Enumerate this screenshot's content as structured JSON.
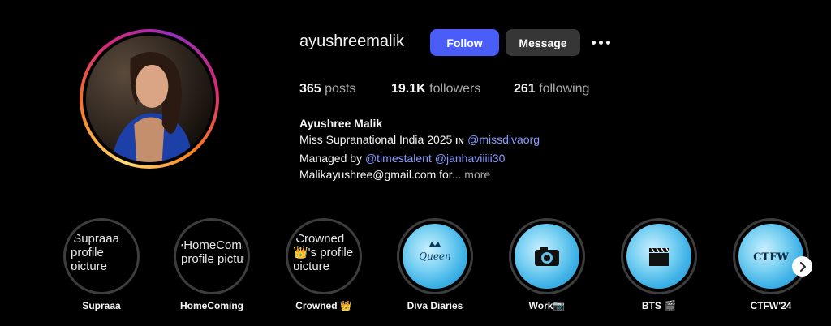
{
  "profile": {
    "username": "ayushreemalik",
    "follow_label": "Follow",
    "message_label": "Message"
  },
  "stats": {
    "posts_count": "365",
    "posts_label": "posts",
    "followers_count": "19.1K",
    "followers_label": "followers",
    "following_count": "261",
    "following_label": "following"
  },
  "bio": {
    "name": "Ayushree Malik",
    "line1_text": "Miss Supranational India 2025 ",
    "line1_badge": "IN",
    "line1_mention": "@missdivaorg",
    "line2_text": "Managed by ",
    "line2_mention1": "@timestalent",
    "line2_mention2": "@janhaviiiii30",
    "line3_text": "Malikayushree@gmail.com for...",
    "more_label": "more"
  },
  "highlights": [
    {
      "label": "Supraaa",
      "alt_line1": "Supraaa",
      "alt_line2": "profile",
      "alt_line3": "picture",
      "type": "broken"
    },
    {
      "label": "HomeComing",
      "alt_line1": "HomeComin",
      "alt_line2": "profile pictur",
      "alt_line3": "",
      "type": "broken"
    },
    {
      "label": "Crowned 👑",
      "alt_line1": "Crowned",
      "alt_line2": "👑's profile",
      "alt_line3": "picture",
      "type": "broken"
    },
    {
      "label": "Diva Diaries",
      "cover_text": "Queen",
      "type": "blue",
      "icon": "crown-icon"
    },
    {
      "label": "Work📷",
      "type": "blue",
      "icon": "camera-icon"
    },
    {
      "label": "BTS 🎬",
      "type": "blue",
      "icon": "clapperboard-icon"
    },
    {
      "label": "CTFW'24",
      "cover_text": "CTFW",
      "type": "blue",
      "icon": "none"
    }
  ],
  "colors": {
    "background": "#000000",
    "follow_button": "#4a5df9",
    "message_button": "#363636",
    "link": "#8a9cff",
    "muted": "#a8a8a8"
  }
}
